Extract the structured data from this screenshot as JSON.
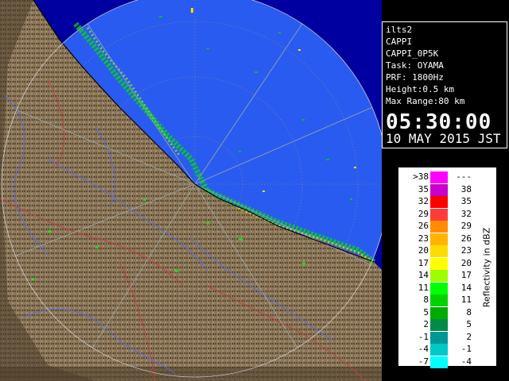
{
  "info": {
    "lines": [
      "ilts2",
      "CAPPI",
      "CAPPI_0P5K",
      "Task: OYAMA",
      "PRF: 1800Hz",
      "Height:0.5 km",
      "Max Range:80 km"
    ],
    "time": "05:30:00",
    "date": "10 MAY 2015 JST"
  },
  "legend": {
    "axis_label": "Reflectivity in dBZ",
    "rows": [
      {
        "low": ">38",
        "high": "---",
        "color": "#ff00ff"
      },
      {
        "low": "35",
        "high": "38",
        "color": "#c800c8"
      },
      {
        "low": "32",
        "high": "35",
        "color": "#ff0000"
      },
      {
        "low": "29",
        "high": "32",
        "color": "#ff3c3c"
      },
      {
        "low": "26",
        "high": "29",
        "color": "#ff8c00"
      },
      {
        "low": "23",
        "high": "26",
        "color": "#ffb400"
      },
      {
        "low": "20",
        "high": "23",
        "color": "#ffdc00"
      },
      {
        "low": "17",
        "high": "20",
        "color": "#ffff00"
      },
      {
        "low": "14",
        "high": "17",
        "color": "#9bff00"
      },
      {
        "low": "11",
        "high": "14",
        "color": "#00ff00"
      },
      {
        "low": "8",
        "high": "11",
        "color": "#00d200"
      },
      {
        "low": "5",
        "high": "8",
        "color": "#00aa00"
      },
      {
        "low": "2",
        "high": "5",
        "color": "#008c46"
      },
      {
        "low": "-1",
        "high": "2",
        "color": "#009696"
      },
      {
        "low": "-4",
        "high": "-1",
        "color": "#00c8c8"
      },
      {
        "low": "-7",
        "high": "-4",
        "color": "#00ffff"
      }
    ]
  },
  "map": {
    "colors": {
      "ocean_radar": "#2a5bf0",
      "ocean_far": "#0000a0",
      "land": "#8a7658",
      "land_dark": "#4e4030",
      "rivers": "#5a6bd8",
      "borders": "#c04040"
    }
  }
}
